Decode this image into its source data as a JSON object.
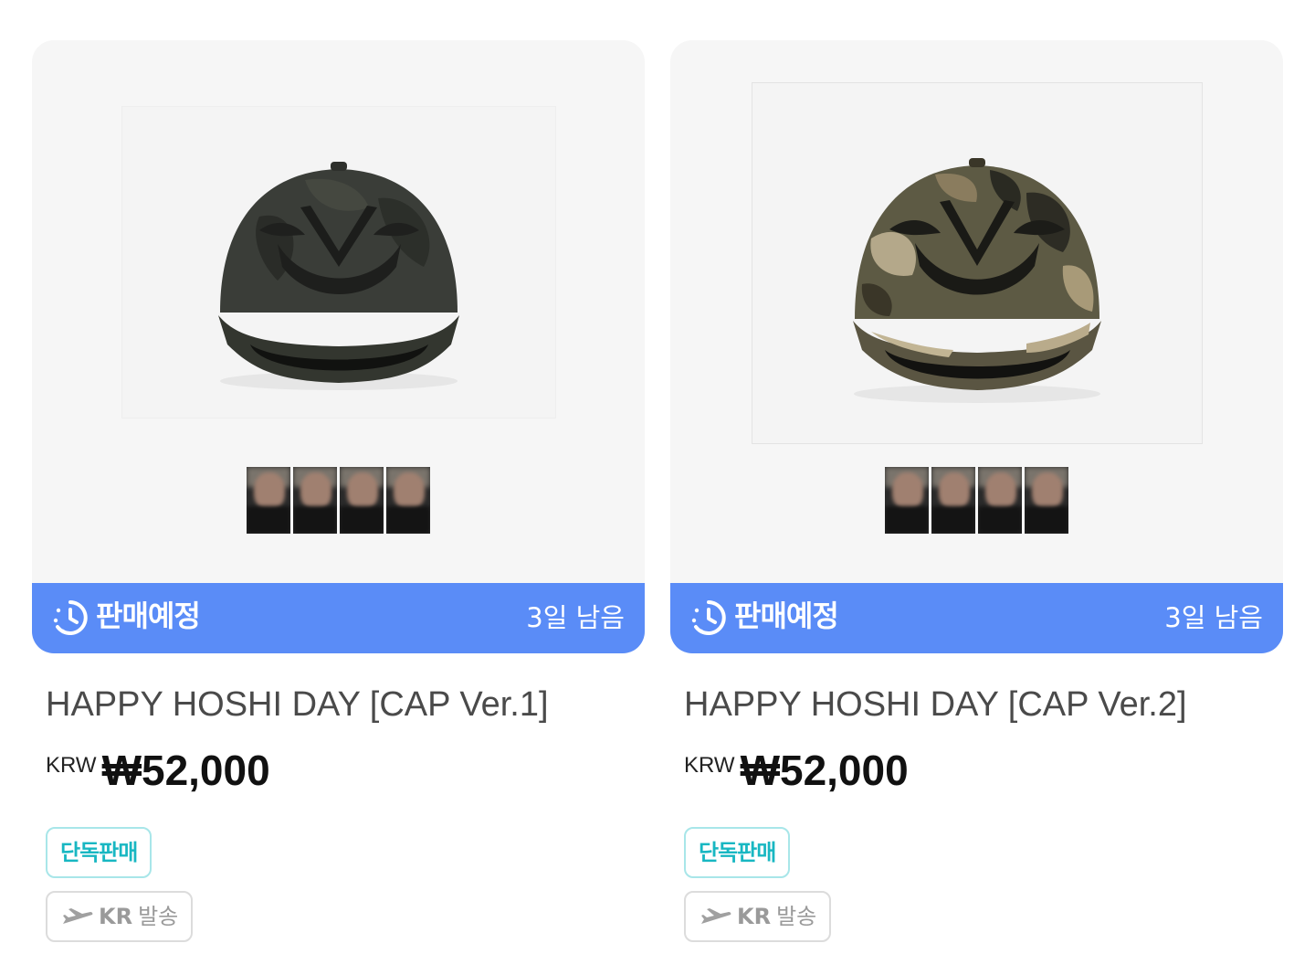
{
  "products": [
    {
      "status_label": "판매예정",
      "status_remaining": "3일 남음",
      "title": "HAPPY HOSHI DAY [CAP Ver.1]",
      "currency": "KRW",
      "price": "₩52,000",
      "badge_exclusive": "단독판매",
      "shipping_region": "KR",
      "shipping_label": "발송",
      "image": "black camo baseball cap with dark embroidered logo",
      "colors": {
        "cap_base": "#3a3d38",
        "cap_camo": "#2a2c28"
      }
    },
    {
      "status_label": "판매예정",
      "status_remaining": "3일 남음",
      "title": "HAPPY HOSHI DAY [CAP Ver.2]",
      "currency": "KRW",
      "price": "₩52,000",
      "badge_exclusive": "단독판매",
      "shipping_region": "KR",
      "shipping_label": "발송",
      "image": "woodland camo baseball cap with black embroidered logo",
      "colors": {
        "cap_base": "#5d5a44",
        "cap_camo": "#b4a88a"
      }
    }
  ],
  "icons": {
    "status": "clock-icon",
    "shipping": "airplane-icon"
  },
  "theme": {
    "status_bar": "#5a8cf7",
    "exclusive_text": "#18b7c2",
    "exclusive_border": "#a8e6e9",
    "ship_border": "#dcdcdc"
  }
}
